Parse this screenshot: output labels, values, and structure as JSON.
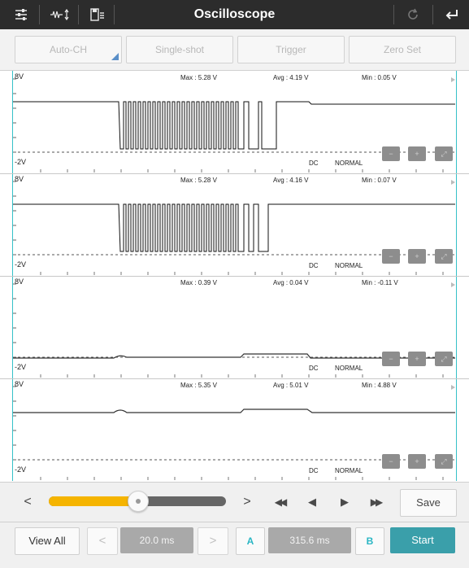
{
  "header": {
    "title": "Oscilloscope",
    "icons": [
      "sliders-icon",
      "waveform-adjust-icon",
      "save-file-icon",
      "refresh-icon",
      "back-icon"
    ]
  },
  "modes": [
    {
      "label": "Auto-CH"
    },
    {
      "label": "Single-shot"
    },
    {
      "label": "Trigger"
    },
    {
      "label": "Zero Set"
    }
  ],
  "channels": [
    {
      "top_label": "8V",
      "bottom_label": "-2V",
      "max": "Max : 5.28 V",
      "avg": "Avg : 4.19 V",
      "min": "Min : 0.05 V",
      "coupling": "DC",
      "mode": "NORMAL"
    },
    {
      "top_label": "8V",
      "bottom_label": "-2V",
      "max": "Max : 5.28 V",
      "avg": "Avg : 4.16 V",
      "min": "Min : 0.07 V",
      "coupling": "DC",
      "mode": "NORMAL"
    },
    {
      "top_label": "8V",
      "bottom_label": "-2V",
      "max": "Max : 0.39 V",
      "avg": "Avg : 0.04 V",
      "min": "Min : -0.11 V",
      "coupling": "DC",
      "mode": "NORMAL"
    },
    {
      "top_label": "8V",
      "bottom_label": "-2V",
      "max": "Max : 5.35 V",
      "avg": "Avg : 5.01 V",
      "min": "Min : 4.88 V",
      "coupling": "DC",
      "mode": "NORMAL"
    }
  ],
  "navigation": {
    "prev_glyph": "<",
    "next_glyph": ">",
    "rewind_glyph": "◀◀",
    "step_back_glyph": "◀",
    "play_glyph": "▶",
    "fast_forward_glyph": "▶▶",
    "save_label": "Save",
    "slider_position": 0.5
  },
  "controls": {
    "view_all_label": "View All",
    "timebase_prev": "<",
    "timebase_value": "20.0 ms",
    "timebase_next": ">",
    "cursor_a_label": "A",
    "cursor_delta_value": "315.6 ms",
    "cursor_b_label": "B",
    "start_label": "Start"
  },
  "colors": {
    "accent": "#3a9faa",
    "slider": "#f5b400",
    "cursor": "#35c0c8"
  }
}
